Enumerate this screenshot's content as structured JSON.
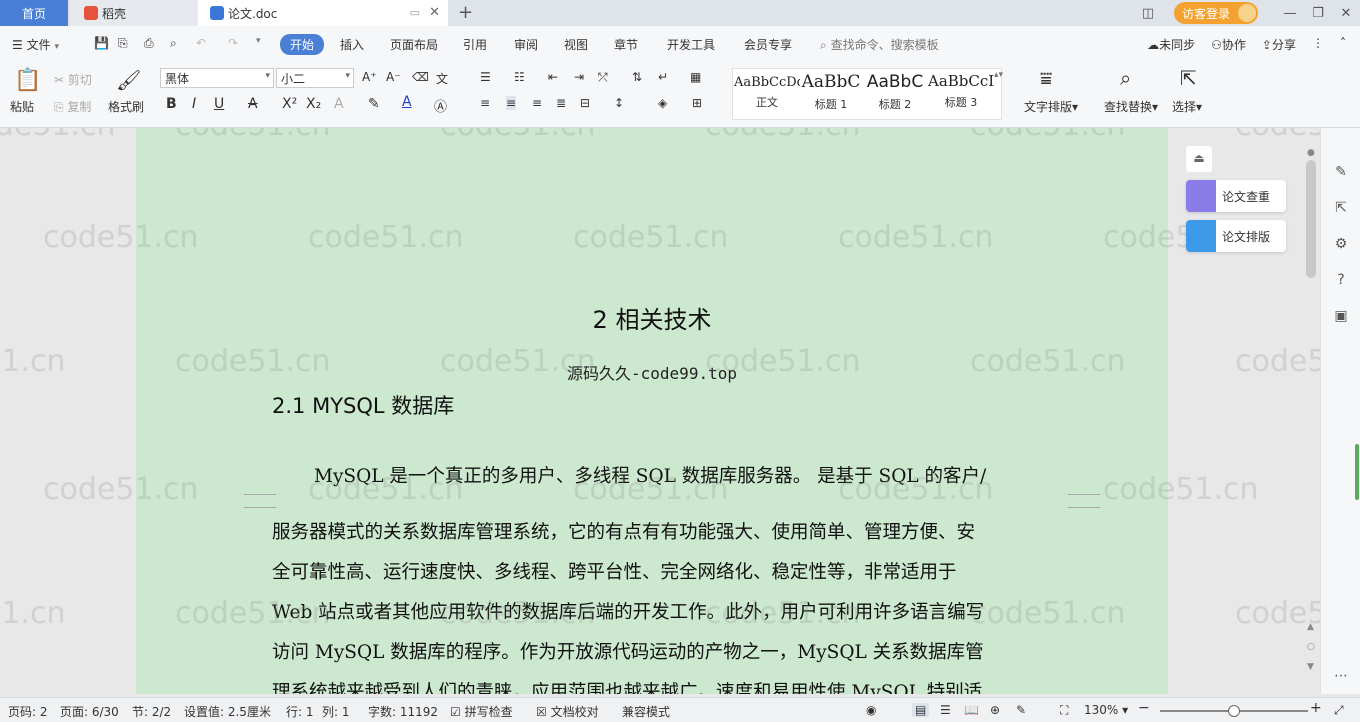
{
  "tabs": {
    "home": "首页",
    "daoke": "稻壳",
    "doc": "论文.doc",
    "add": "+",
    "visitor": "访客登录"
  },
  "menu": {
    "file": "文件",
    "items": [
      "开始",
      "插入",
      "页面布局",
      "引用",
      "审阅",
      "视图",
      "章节",
      "开发工具",
      "会员专享"
    ],
    "search": "查找命令、搜索模板",
    "sync": "未同步",
    "collab": "协作",
    "share": "分享"
  },
  "ribbon": {
    "paste": "粘贴",
    "cut": "剪切",
    "copy": "复制",
    "format_painter": "格式刷",
    "font": "黑体",
    "size": "小二",
    "styles": [
      {
        "sample": "AaBbCcDd",
        "label": "正文"
      },
      {
        "sample": "AaBbC",
        "label": "标题 1"
      },
      {
        "sample": "AaBbC",
        "label": "标题 2"
      },
      {
        "sample": "AaBbCcI",
        "label": "标题 3"
      }
    ],
    "text_layout": "文字排版",
    "find_replace": "查找替换",
    "select": "选择"
  },
  "document": {
    "heading": "2 相关技术",
    "subtitle": "源码久久-code99.top",
    "section": "2.1 MYSQL 数据库",
    "lines": [
      "MySQL 是一个真正的多用户、多线程 SQL 数据库服务器。 是基于 SQL 的客户/",
      "服务器模式的关系数据库管理系统，它的有点有有功能强大、使用简单、管理方便、安",
      "全可靠性高、运行速度快、多线程、跨平台性、完全网络化、稳定性等，非常适用于",
      "Web 站点或者其他应用软件的数据库后端的开发工作。此外，用户可利用许多语言编写",
      "访问 MySQL 数据库的程序。作为开放源代码运动的产物之一，MySQL 关系数据库管",
      "理系统越来越受到人们的青睐，应用范围也越来越广。速度和易用性使 MySQL 特别适"
    ],
    "watermark": "code51.cn"
  },
  "side_panel": {
    "check": "论文查重",
    "layout": "论文排版"
  },
  "status": {
    "page_num": "页码: 2",
    "page": "页面: 6/30",
    "section": "节: 2/2",
    "setting": "设置值: 2.5厘米",
    "line": "行: 1",
    "col": "列: 1",
    "words": "字数: 11192",
    "spell": "拼写检查",
    "proof": "文档校对",
    "compat": "兼容模式",
    "zoom": "130%",
    "zoom_fraction": 0.5
  },
  "colors": {
    "accent": "#4a7fd6",
    "page_bg": "#cce8cf",
    "visitor": "#f3a230"
  }
}
